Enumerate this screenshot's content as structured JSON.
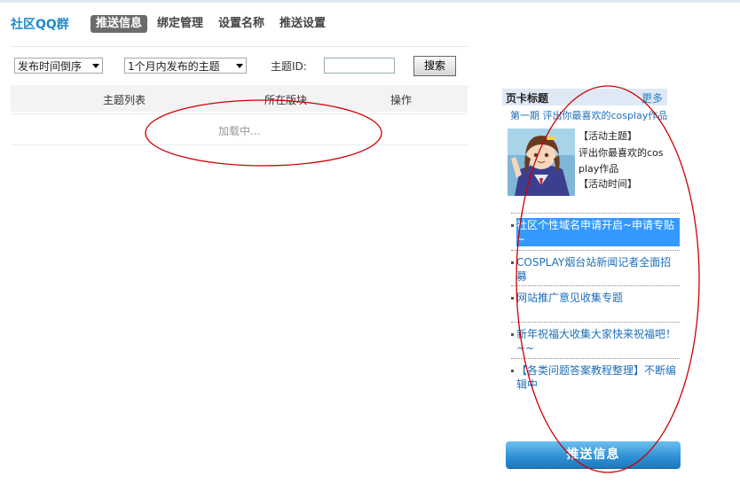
{
  "header": {
    "brand": "社区QQ群",
    "tabs": [
      {
        "label": "推送信息",
        "active": true
      },
      {
        "label": "绑定管理",
        "active": false
      },
      {
        "label": "设置名称",
        "active": false
      },
      {
        "label": "推送设置",
        "active": false
      }
    ]
  },
  "filters": {
    "sort_selected": "发布时间倒序",
    "range_selected": "1个月内发布的主题",
    "topic_id_label": "主题ID:",
    "topic_id_value": "",
    "search_label": "搜索"
  },
  "table": {
    "columns": [
      "主题列表",
      "所在版块",
      "操作"
    ],
    "loading_text": "加载中..."
  },
  "sidebar": {
    "title": "页卡标题",
    "more": "更多",
    "featured_link": "第一期 评出你最喜欢的cosplay作品",
    "info": {
      "line1": "【活动主题】",
      "line2": "评出你最喜欢的cos",
      "line3": "play作品",
      "line4": "【活动时间】"
    },
    "news": [
      {
        "text": "社区个性域名申请开启~申请专贴~",
        "selected": true
      },
      {
        "text": "COSPLAY烟台站新闻记者全面招募",
        "selected": false
      },
      {
        "text": "网站推广意见收集专题",
        "selected": false
      },
      {
        "text": "新年祝福大收集大家快来祝福吧！~~",
        "selected": false
      },
      {
        "text": "【各类问题答案教程整理】不断编辑中",
        "selected": false
      }
    ],
    "push_button": "推送信息"
  },
  "colors": {
    "accent": "#1f8ac9",
    "annotation": "#cc0000",
    "button": "#2d8fd4"
  }
}
